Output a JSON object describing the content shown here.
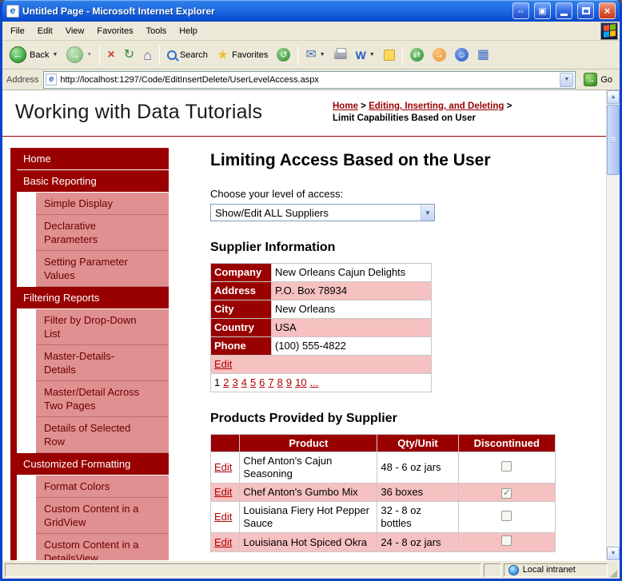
{
  "window": {
    "title": "Untitled Page - Microsoft Internet Explorer",
    "status": "Local intranet"
  },
  "menu": {
    "items": [
      "File",
      "Edit",
      "View",
      "Favorites",
      "Tools",
      "Help"
    ]
  },
  "toolbar": {
    "back": "Back",
    "search": "Search",
    "favorites": "Favorites"
  },
  "address": {
    "label": "Address",
    "url": "http://localhost:1297/Code/EditInsertDelete/UserLevelAccess.aspx",
    "go": "Go"
  },
  "icons": {
    "back_arrow": "←",
    "forward_arrow": "→",
    "stop": "×",
    "refresh": "↻",
    "home": "⌂",
    "star": "★",
    "mail": "✉",
    "word": "W",
    "history": "↺",
    "sync": "⇄",
    "research": "→",
    "messenger": "☺",
    "grid": "▦",
    "dropdown": "▼",
    "go_arrow": "→",
    "scroll_up": "▲",
    "scroll_down": "▼",
    "check": "✓",
    "pan": "⇔",
    "panel": "▣",
    "close": "×",
    "grip": "◢"
  },
  "colors": {
    "maroon": "#990000",
    "sidebar_pink": "#E09090",
    "row_pink": "#F6C1C1",
    "link_red": "#B00000",
    "xp_blue": "#1C5AE0",
    "chrome_tan": "#ECE9D8"
  },
  "page": {
    "site_title": "Working with Data Tutorials",
    "breadcrumb": {
      "links": [
        "Home",
        "Editing, Inserting, and Deleting"
      ],
      "separator": ">",
      "current": "Limit Capabilities Based on User"
    },
    "sidebar": {
      "items": [
        {
          "label": "Home",
          "type": "section"
        },
        {
          "label": "Basic Reporting",
          "type": "section"
        },
        {
          "label": "Simple Display",
          "type": "sub"
        },
        {
          "label": "Declarative Parameters",
          "type": "sub"
        },
        {
          "label": "Setting Parameter Values",
          "type": "sub"
        },
        {
          "label": "Filtering Reports",
          "type": "section"
        },
        {
          "label": "Filter by Drop-Down List",
          "type": "sub"
        },
        {
          "label": "Master-Details-Details",
          "type": "sub"
        },
        {
          "label": "Master/Detail Across Two Pages",
          "type": "sub"
        },
        {
          "label": "Details of Selected Row",
          "type": "sub"
        },
        {
          "label": "Customized Formatting",
          "type": "section"
        },
        {
          "label": "Format Colors",
          "type": "sub"
        },
        {
          "label": "Custom Content in a GridView",
          "type": "sub"
        },
        {
          "label": "Custom Content in a DetailsView",
          "type": "sub"
        }
      ]
    },
    "main": {
      "title": "Limiting Access Based on the User",
      "access_label": "Choose your level of access:",
      "access_value": "Show/Edit ALL Suppliers",
      "supplier_heading": "Supplier Information",
      "supplier": {
        "fields": [
          {
            "label": "Company",
            "value": "New Orleans Cajun Delights"
          },
          {
            "label": "Address",
            "value": "P.O. Box 78934"
          },
          {
            "label": "City",
            "value": "New Orleans"
          },
          {
            "label": "Country",
            "value": "USA"
          },
          {
            "label": "Phone",
            "value": "(100) 555-4822"
          }
        ],
        "edit": "Edit",
        "pager": [
          "1",
          "2",
          "3",
          "4",
          "5",
          "6",
          "7",
          "8",
          "9",
          "10",
          "..."
        ],
        "current_page": "1"
      },
      "products_heading": "Products Provided by Supplier",
      "products": {
        "headers": [
          "",
          "Product",
          "Qty/Unit",
          "Discontinued"
        ],
        "edit": "Edit",
        "rows": [
          {
            "product": "Chef Anton's Cajun Seasoning",
            "qty": "48 - 6 oz jars",
            "discontinued": false
          },
          {
            "product": "Chef Anton's Gumbo Mix",
            "qty": "36 boxes",
            "discontinued": true
          },
          {
            "product": "Louisiana Fiery Hot Pepper Sauce",
            "qty": "32 - 8 oz bottles",
            "discontinued": false
          },
          {
            "product": "Louisiana Hot Spiced Okra",
            "qty": "24 - 8 oz jars",
            "discontinued": false
          }
        ]
      }
    }
  }
}
